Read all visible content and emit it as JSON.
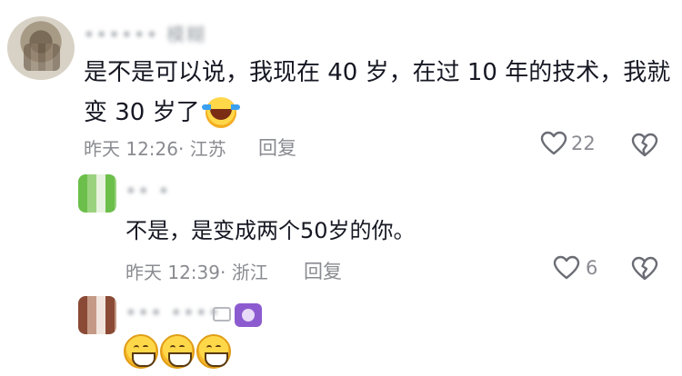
{
  "comments": [
    {
      "username": "•••••• 模糊",
      "text_line1": "是不是可以说，我现在 40 岁，在过 10 年的技术，我就",
      "text_line2": "变 30 岁了",
      "emoji": "crying-laughing-emoji",
      "meta": "昨天 12:26· 江苏",
      "reply_label": "回复",
      "likes": "22"
    }
  ],
  "replies": [
    {
      "username": "•• •",
      "text": "不是，是变成两个50岁的你。",
      "meta": "昨天 12:39· 浙江",
      "reply_label": "回复",
      "likes": "6"
    },
    {
      "username": "••• ••••",
      "emojis": [
        "grinning-emoji",
        "grinning-emoji",
        "grinning-emoji"
      ]
    }
  ],
  "icons": {
    "like": "heart-outline-icon",
    "dislike": "broken-heart-icon"
  },
  "colors": {
    "text": "#161823",
    "meta": "#8a8b91",
    "icon_stroke": "#6b6d75",
    "badge": "#8d5bd0"
  }
}
